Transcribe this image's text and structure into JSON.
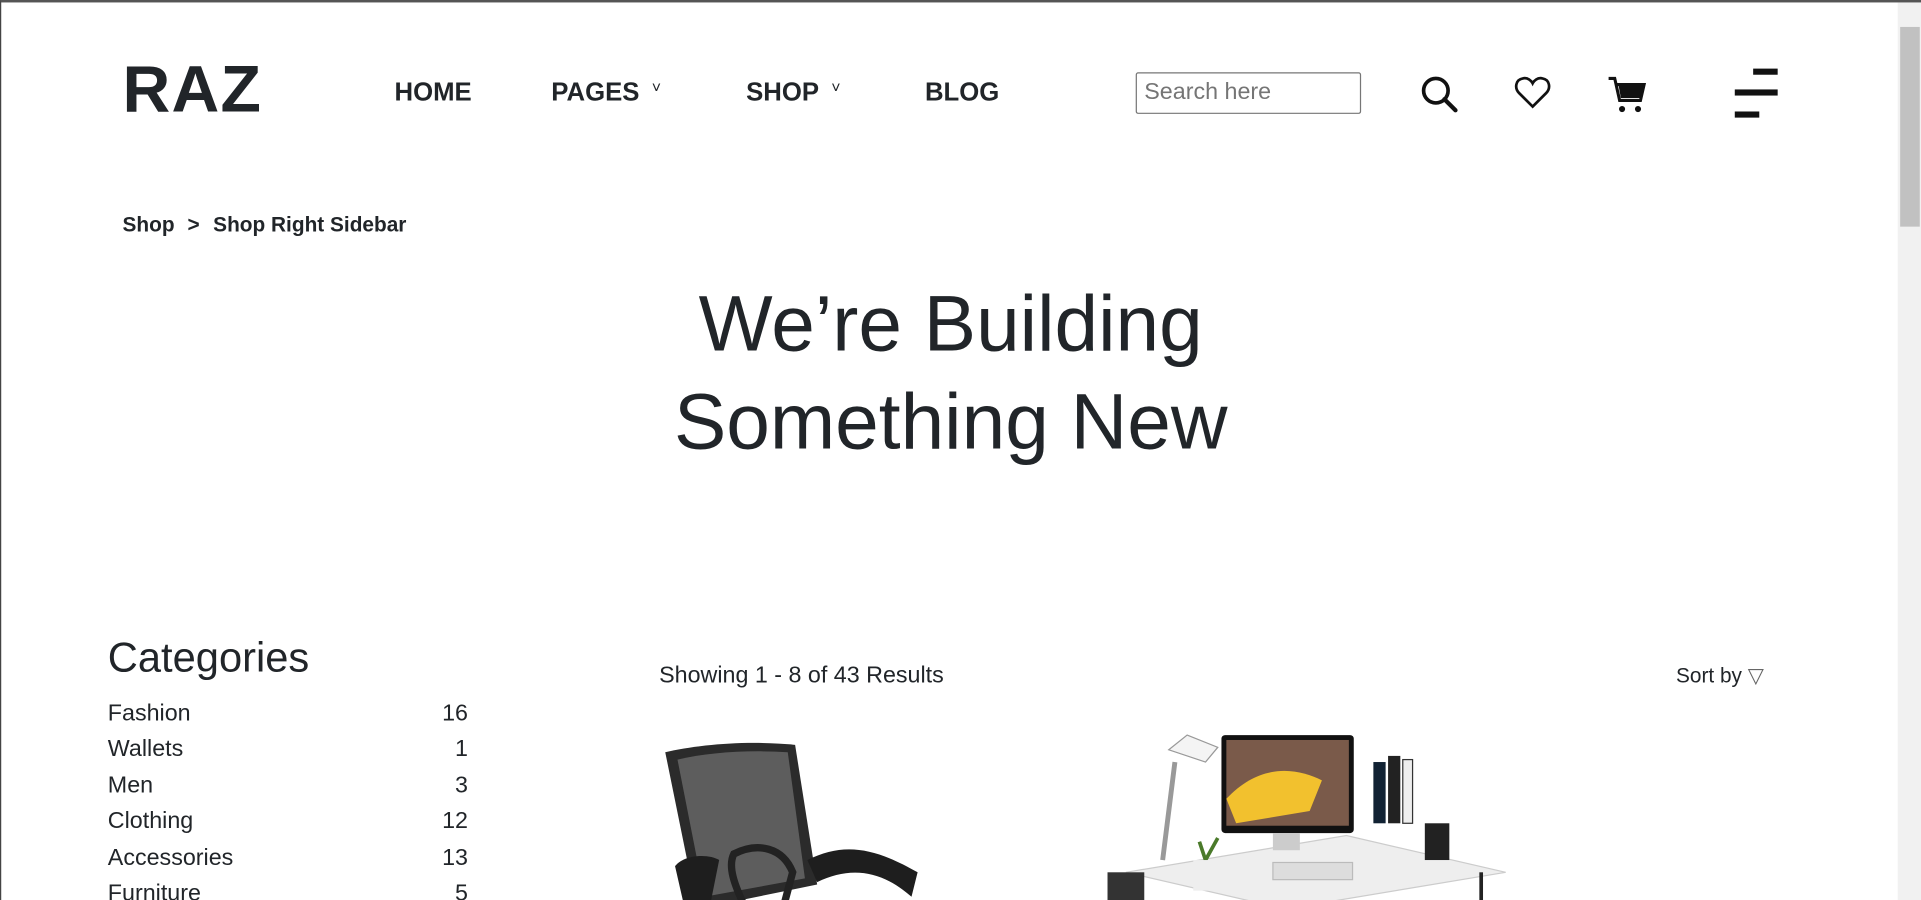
{
  "header": {
    "logo": "RAZ",
    "nav": [
      {
        "label": "HOME",
        "dropdown": false
      },
      {
        "label": "PAGES",
        "dropdown": true
      },
      {
        "label": "SHOP",
        "dropdown": true
      },
      {
        "label": "BLOG",
        "dropdown": false
      }
    ],
    "chevron": "˅",
    "search_placeholder": "Search here",
    "icons": [
      "search-icon",
      "heart-icon",
      "cart-icon",
      "menu-icon"
    ]
  },
  "breadcrumb": {
    "items": [
      "Shop",
      "Shop Right Sidebar"
    ],
    "separator": ">"
  },
  "hero": {
    "line1": "We’re Building",
    "line2": "Something New"
  },
  "sidebar": {
    "title": "Categories",
    "categories": [
      {
        "name": "Fashion",
        "count": "16"
      },
      {
        "name": "Wallets",
        "count": "1"
      },
      {
        "name": "Men",
        "count": "3"
      },
      {
        "name": "Clothing",
        "count": "12"
      },
      {
        "name": "Accessories",
        "count": "13"
      },
      {
        "name": "Furniture",
        "count": "5"
      }
    ]
  },
  "results": {
    "showing": "Showing 1 - 8 of 43 Results",
    "sort_label": "Sort by",
    "sort_icon": "▽"
  },
  "products": [
    {
      "image": "office-chair"
    },
    {
      "image": "desk-setup"
    }
  ]
}
